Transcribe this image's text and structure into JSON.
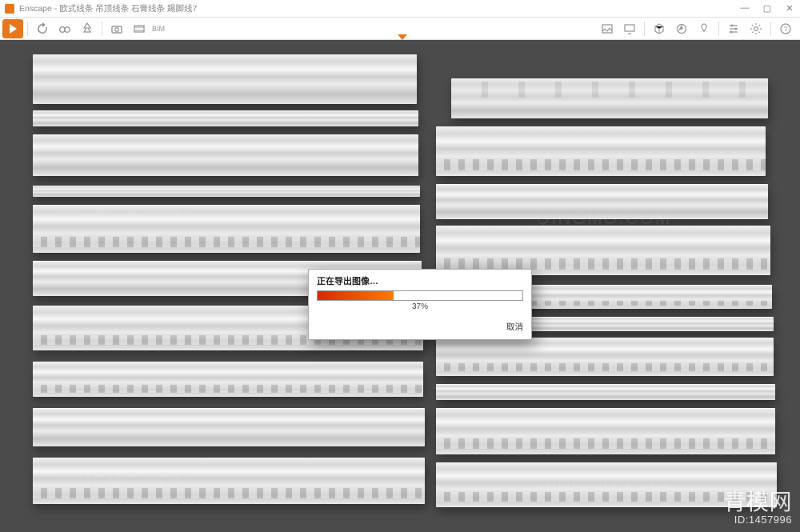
{
  "window": {
    "app_name": "Enscape",
    "title_sep": " - ",
    "file_title": "欧式线条 吊顶线条 石膏线条 踢脚线7"
  },
  "toolbar": {
    "bim_label": "BIM"
  },
  "dialog": {
    "title": "正在导出图像…",
    "percent_text": "37%",
    "percent_value": 37,
    "cancel_label": "取消"
  },
  "watermark": {
    "brand": "青模网",
    "id_label": "ID:1457996",
    "small": "QINGMO.COM"
  },
  "colors": {
    "accent": "#e8761a",
    "progress_start": "#d82a00",
    "progress_end": "#ff7a00",
    "viewport_bg": "#4b4b4b"
  }
}
